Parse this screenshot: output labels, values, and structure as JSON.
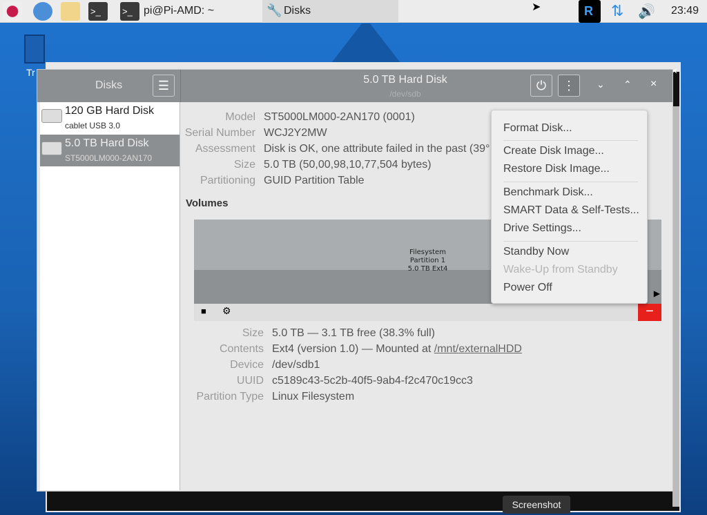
{
  "taskbar": {
    "terminal_title": "pi@Pi-AMD: ~",
    "disks_title": "Disks",
    "clock": "23:49"
  },
  "desktop": {
    "trash_label": "Tr"
  },
  "sidebar": {
    "title": "Disks",
    "items": [
      {
        "name": "120 GB Hard Disk",
        "sub": "cablet USB 3.0"
      },
      {
        "name": "5.0 TB Hard Disk",
        "sub": "ST5000LM000-2AN170"
      }
    ]
  },
  "header": {
    "title": "5.0 TB Hard Disk",
    "subtitle": "/dev/sdb"
  },
  "disk": {
    "fields": [
      {
        "label": "Model",
        "value": "ST5000LM000-2AN170 (0001)"
      },
      {
        "label": "Serial Number",
        "value": "WCJ2Y2MW"
      },
      {
        "label": "Assessment",
        "value": "Disk is OK, one attribute failed in the past (39°"
      },
      {
        "label": "Size",
        "value": "5.0 TB (50,00,98,10,77,504 bytes)"
      },
      {
        "label": "Partitioning",
        "value": "GUID Partition Table"
      }
    ]
  },
  "volumes": {
    "heading": "Volumes",
    "partition": [
      "Filesystem",
      "Partition 1",
      "5.0 TB Ext4"
    ],
    "fields": [
      {
        "label": "Size",
        "value": "5.0 TB — 3.1 TB free (38.3% full)"
      },
      {
        "label": "Contents",
        "value": "Ext4 (version 1.0) — Mounted at ",
        "link": "/mnt/externalHDD"
      },
      {
        "label": "Device",
        "value": "/dev/sdb1"
      },
      {
        "label": "UUID",
        "value": "c5189c43-5c2b-40f5-9ab4-f2c470c19cc3"
      },
      {
        "label": "Partition Type",
        "value": "Linux Filesystem"
      }
    ]
  },
  "menu": [
    "Format Disk...",
    "Create Disk Image...",
    "Restore Disk Image...",
    "Benchmark Disk...",
    "SMART Data & Self-Tests...",
    "Drive Settings...",
    "Standby Now",
    "Wake-Up from Standby",
    "Power Off"
  ],
  "tooltip": "Screenshot",
  "colors": {
    "desktop": "#1f74cf",
    "header": "#8c8f92",
    "selected": "#8c8f92",
    "delete": "#e8201c"
  }
}
